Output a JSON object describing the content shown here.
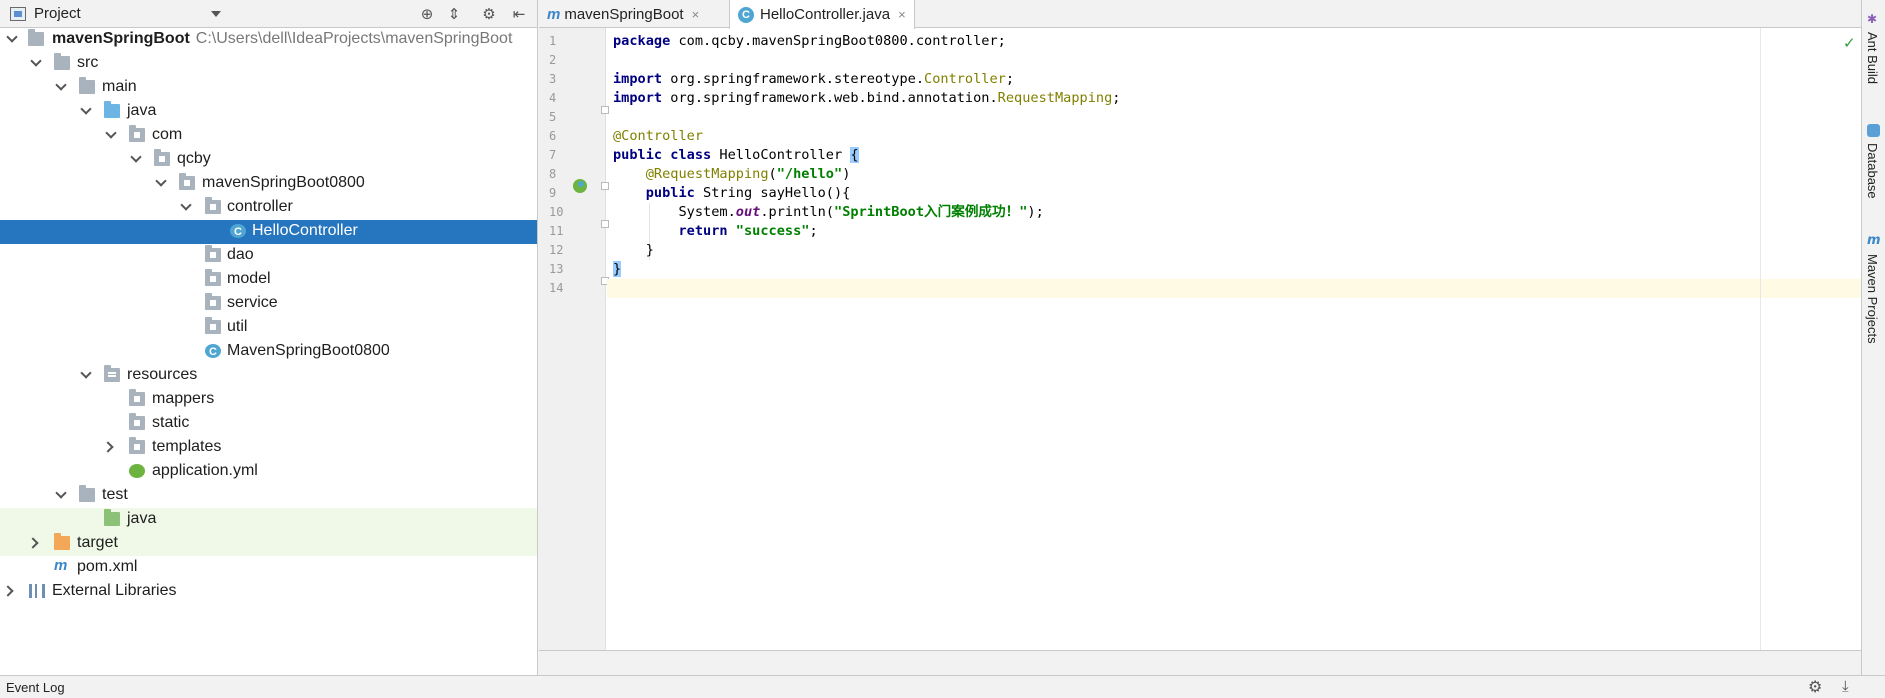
{
  "project_panel": {
    "title": "Project",
    "tools": [
      "target-icon",
      "collapse-icon",
      "gear-icon",
      "hide-icon"
    ],
    "tree": [
      {
        "name": "mavenSpringBoot",
        "path": "C:\\Users\\dell\\IdeaProjects\\mavenSpringBoot"
      },
      {
        "name": "src"
      },
      {
        "name": "main"
      },
      {
        "name": "java"
      },
      {
        "name": "com"
      },
      {
        "name": "qcby"
      },
      {
        "name": "mavenSpringBoot0800"
      },
      {
        "name": "controller"
      },
      {
        "name": "HelloController"
      },
      {
        "name": "dao"
      },
      {
        "name": "model"
      },
      {
        "name": "service"
      },
      {
        "name": "util"
      },
      {
        "name": "MavenSpringBoot0800"
      },
      {
        "name": "resources"
      },
      {
        "name": "mappers"
      },
      {
        "name": "static"
      },
      {
        "name": "templates"
      },
      {
        "name": "application.yml"
      },
      {
        "name": "test"
      },
      {
        "name": "java"
      },
      {
        "name": "target"
      },
      {
        "name": "pom.xml"
      },
      {
        "name": "External Libraries"
      }
    ]
  },
  "editor": {
    "tabs": [
      {
        "label": "mavenSpringBoot",
        "close": "×"
      },
      {
        "label": "HelloController.java",
        "close": "×"
      }
    ],
    "line_numbers": [
      "1",
      "2",
      "3",
      "4",
      "5",
      "6",
      "7",
      "8",
      "9",
      "10",
      "11",
      "12",
      "13",
      "14"
    ],
    "code": {
      "l1_kw": "package",
      "l1_rest": " com.qcby.mavenSpringBoot0800.controller;",
      "l3_kw": "import",
      "l3_rest": " org.springframework.stereotype.",
      "l3_ann": "Controller",
      "l3_end": ";",
      "l4_kw": "import",
      "l4_rest": " org.springframework.web.bind.annotation.",
      "l4_ann": "RequestMapping",
      "l4_end": ";",
      "l6_ann": "@Controller",
      "l7_kw": "public class",
      "l7_rest": " HelloController ",
      "l7_brace": "{",
      "l8_ann": "@RequestMapping",
      "l8_open": "(",
      "l8_str": "\"/hello\"",
      "l8_close": ")",
      "l9_kw": "public",
      "l9_rest": " String sayHello(){",
      "l10_a": "System.",
      "l10_field": "out",
      "l10_b": ".println(",
      "l10_str": "\"SprintBoot入门案例成功！\"",
      "l10_c": ");",
      "l11_kw": "return",
      "l11_sp": " ",
      "l11_str": "\"success\"",
      "l11_end": ";",
      "l12": "}",
      "l13": "}"
    }
  },
  "right_tools": [
    "Ant Build",
    "Database",
    "Maven Projects"
  ],
  "status_bar": {
    "event_log": "Event Log"
  }
}
